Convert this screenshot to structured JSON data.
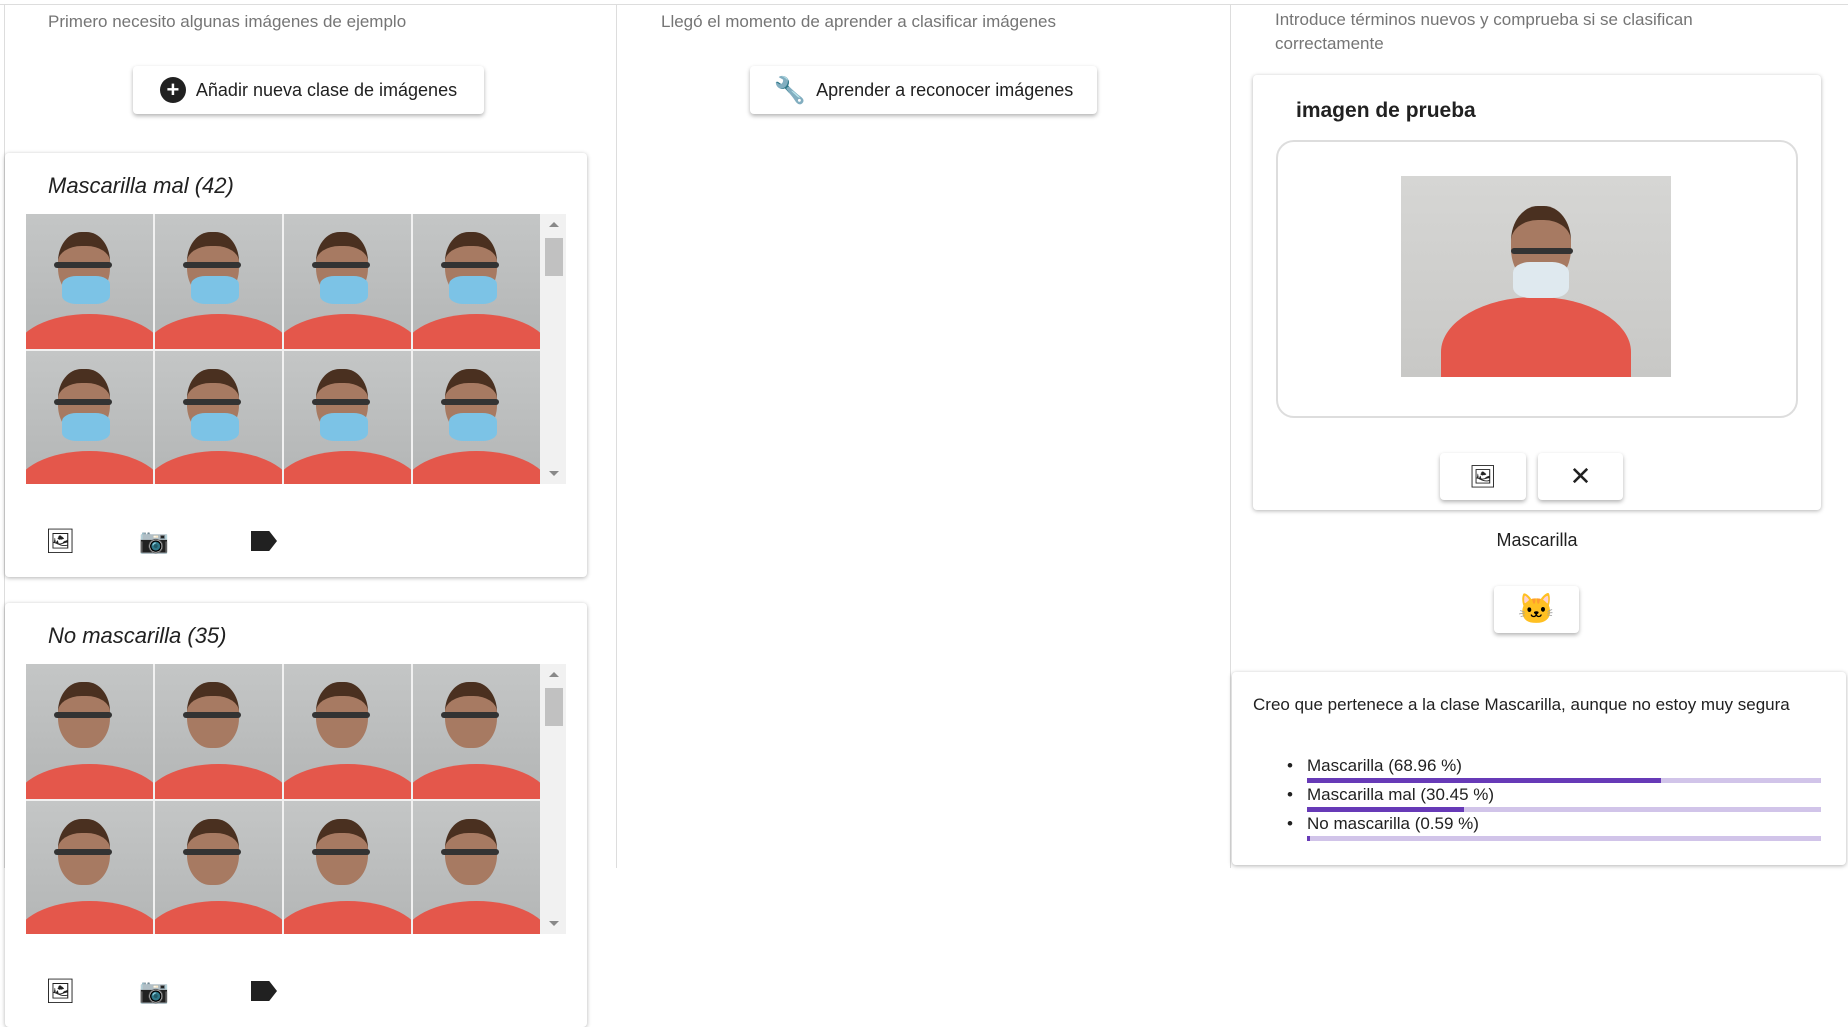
{
  "col1": {
    "hint": "Primero necesito algunas imágenes de ejemplo",
    "add_class_label": "Añadir nueva clase de imágenes",
    "classes": [
      {
        "title": "Mascarilla mal (42)",
        "mask": true
      },
      {
        "title": "No mascarilla (35)",
        "mask": false
      }
    ]
  },
  "col2": {
    "hint": "Llegó el momento de aprender a clasificar imágenes",
    "train_label": "Aprender a reconocer imágenes"
  },
  "col3": {
    "hint": "Introduce términos nuevos y comprueba si se clasifican correctamente",
    "test_title": "imagen de prueba",
    "predicted": "Mascarilla",
    "message": "Creo que pertenece a la clase Mascarilla, aunque no estoy muy segura",
    "results": [
      {
        "label": "Mascarilla (68.96 %)",
        "value": 68.96
      },
      {
        "label": "Mascarilla mal (30.45 %)",
        "value": 30.45
      },
      {
        "label": "No mascarilla (0.59 %)",
        "value": 0.59
      }
    ]
  },
  "colors": {
    "accent": "#673ab7",
    "track": "#d1c4e9"
  }
}
